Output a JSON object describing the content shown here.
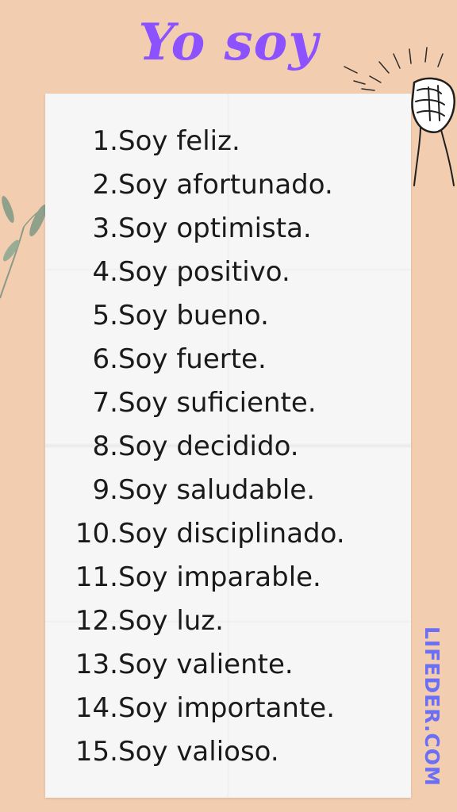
{
  "title": "Yo soy",
  "items": [
    {
      "num": "1.",
      "text": "Soy feliz."
    },
    {
      "num": "2.",
      "text": "Soy afortunado."
    },
    {
      "num": "3.",
      "text": "Soy optimista."
    },
    {
      "num": "4.",
      "text": "Soy positivo."
    },
    {
      "num": "5.",
      "text": "Soy bueno."
    },
    {
      "num": "6.",
      "text": "Soy fuerte."
    },
    {
      "num": "7.",
      "text": "Soy suficiente."
    },
    {
      "num": "8.",
      "text": "Soy decidido."
    },
    {
      "num": "9.",
      "text": "Soy saludable."
    },
    {
      "num": "10.",
      "text": "Soy disciplinado."
    },
    {
      "num": "11.",
      "text": "Soy imparable."
    },
    {
      "num": "12.",
      "text": "Soy luz."
    },
    {
      "num": "13.",
      "text": "Soy valiente."
    },
    {
      "num": "14.",
      "text": "Soy importante."
    },
    {
      "num": "15.",
      "text": "Soy valioso."
    }
  ],
  "watermark": "LIFEDER.COM",
  "colors": {
    "background": "#f3cdb0",
    "title": "#8c52ff",
    "watermark": "#6b6ff5",
    "paper": "#f6f6f6"
  },
  "icons": {
    "left_decoration": "leaf-branch-icon",
    "right_decoration": "raised-fist-icon"
  }
}
